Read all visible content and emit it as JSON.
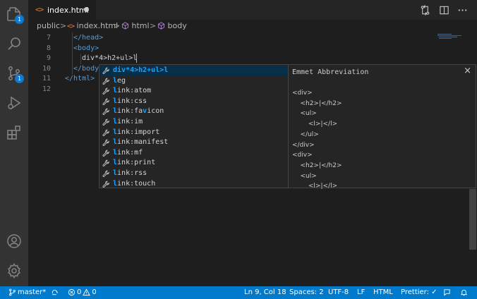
{
  "tab": {
    "filename": "index.html",
    "icon": "html-file-icon"
  },
  "breadcrumb": {
    "folder": "public",
    "file": "index.html",
    "node1": "html",
    "node2": "body"
  },
  "editor": {
    "line_numbers": [
      "7",
      "8",
      "9",
      "10",
      "11",
      "12"
    ],
    "lines": {
      "l7": "</head>",
      "l8": "<body>",
      "l9": "div*4>h2+ul>l",
      "l10": "</body",
      "l11": "</html>"
    }
  },
  "suggest": {
    "items": [
      {
        "prefix": "",
        "match": "div*4>h2+ul>l",
        "rest": ""
      },
      {
        "prefix": "",
        "match": "l",
        "rest": "eg"
      },
      {
        "prefix": "",
        "match": "l",
        "rest": "ink:atom"
      },
      {
        "prefix": "",
        "match": "l",
        "rest": "ink:css"
      },
      {
        "prefix": "",
        "match": "l",
        "rest": "ink:fa",
        "match2": "v",
        "rest2": "icon"
      },
      {
        "prefix": "",
        "match": "l",
        "rest": "ink:im"
      },
      {
        "prefix": "",
        "match": "l",
        "rest": "ink:import"
      },
      {
        "prefix": "",
        "match": "l",
        "rest": "ink:manifest"
      },
      {
        "prefix": "",
        "match": "l",
        "rest": "ink:mf"
      },
      {
        "prefix": "",
        "match": "l",
        "rest": "ink:print"
      },
      {
        "prefix": "",
        "match": "l",
        "rest": "ink:rss"
      },
      {
        "prefix": "",
        "match": "l",
        "rest": "ink:touch"
      }
    ]
  },
  "details": {
    "title": "Emmet Abbreviation",
    "code": "<div>\n    <h2>|</h2>\n    <ul>\n        <l>|</l>\n    </ul>\n</div>\n<div>\n    <h2>|</h2>\n    <ul>\n        <l>|</l>"
  },
  "activity": {
    "explorer_badge": "1",
    "scm_badge": "1"
  },
  "statusbar": {
    "branch": "master*",
    "errors": "0",
    "warnings": "0",
    "position": "Ln 9, Col 18",
    "spaces": "Spaces: 2",
    "encoding": "UTF-8",
    "eol": "LF",
    "language": "HTML",
    "prettier": "Prettier: ✓"
  },
  "colors": {
    "accent": "#007acc",
    "badge": "#0e7ad3",
    "highlight": "#18a3ff",
    "tag": "#569cd6",
    "html_icon": "#e37933"
  }
}
